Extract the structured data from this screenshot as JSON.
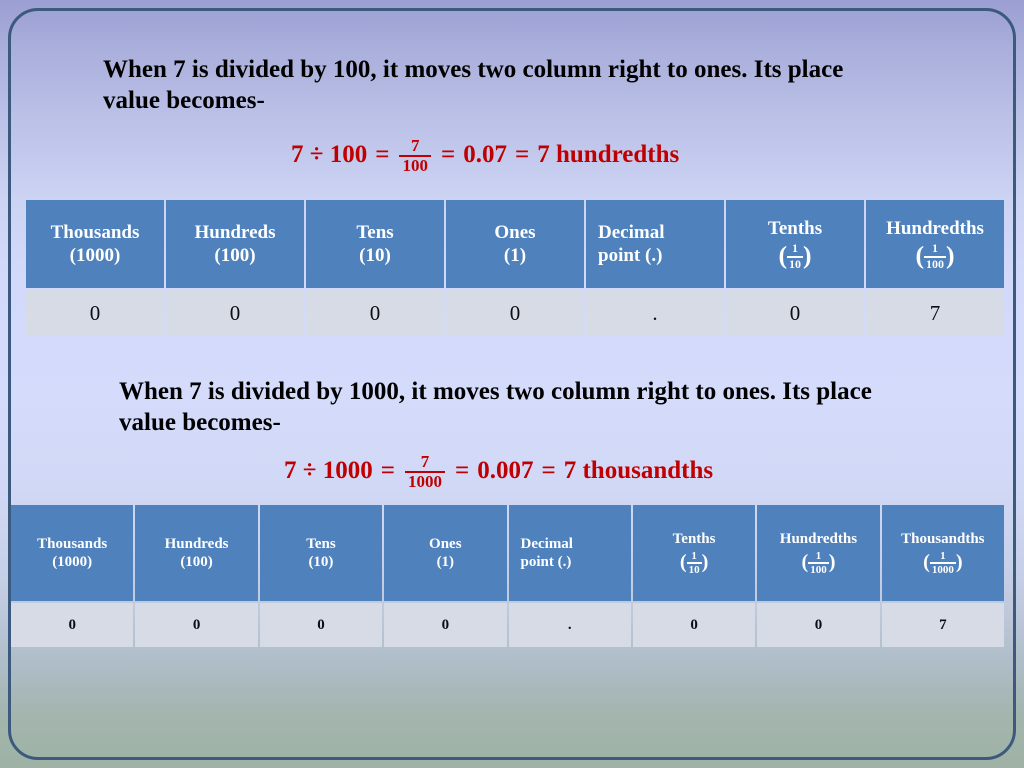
{
  "slide": {
    "accent_blue": "#4F81BD",
    "data_row_bg": "#D7DBE5",
    "formula_red": "#C00000",
    "border_color": "#3C5A7D"
  },
  "section_1": {
    "statement": "When 7 is divided by 100, it moves two column right to ones. Its place value becomes-",
    "formula": {
      "lhs": "7 ÷ 100",
      "eq1": "=",
      "fraction": {
        "numerator": "7",
        "denominator": "100"
      },
      "eq2": "=",
      "decimal": "0.07",
      "eq3": "=",
      "words": "7 hundredths"
    },
    "table": {
      "headers": [
        {
          "name": "Thousands",
          "sub": "(1000)",
          "type": "paren"
        },
        {
          "name": "Hundreds",
          "sub": "(100)",
          "type": "paren"
        },
        {
          "name": "Tens",
          "sub": "(10)",
          "type": "paren"
        },
        {
          "name": "Ones",
          "sub": "(1)",
          "type": "paren"
        },
        {
          "name": "Decimal",
          "sub": "point (.)",
          "type": "text",
          "align": "left"
        },
        {
          "name": "Tenths",
          "numerator": "1",
          "denominator": "10",
          "type": "fraction"
        },
        {
          "name": "Hundredths",
          "numerator": "1",
          "denominator": "100",
          "type": "fraction"
        }
      ],
      "values": [
        "0",
        "0",
        "0",
        "0",
        ".",
        "0",
        "7"
      ]
    }
  },
  "section_2": {
    "statement": "When 7 is divided by 1000, it moves two column right to ones. Its place value becomes-",
    "formula": {
      "lhs": "7 ÷ 1000",
      "eq1": "=",
      "fraction": {
        "numerator": "7",
        "denominator": "1000"
      },
      "eq2": "=",
      "decimal": "0.007",
      "eq3": "=",
      "words": "7 thousandths"
    },
    "table": {
      "headers": [
        {
          "name": "Thousands",
          "sub": "(1000)",
          "type": "paren"
        },
        {
          "name": "Hundreds",
          "sub": "(100)",
          "type": "paren"
        },
        {
          "name": "Tens",
          "sub": "(10)",
          "type": "paren"
        },
        {
          "name": "Ones",
          "sub": "(1)",
          "type": "paren"
        },
        {
          "name": "Decimal",
          "sub": "point (.)",
          "type": "text",
          "align": "left"
        },
        {
          "name": "Tenths",
          "numerator": "1",
          "denominator": "10",
          "type": "fraction"
        },
        {
          "name": "Hundredths",
          "numerator": "1",
          "denominator": "100",
          "type": "fraction"
        },
        {
          "name": "Thousandths",
          "numerator": "1",
          "denominator": "1000",
          "type": "fraction"
        }
      ],
      "values": [
        "0",
        "0",
        "0",
        "0",
        ".",
        "0",
        "0",
        "7"
      ]
    }
  }
}
